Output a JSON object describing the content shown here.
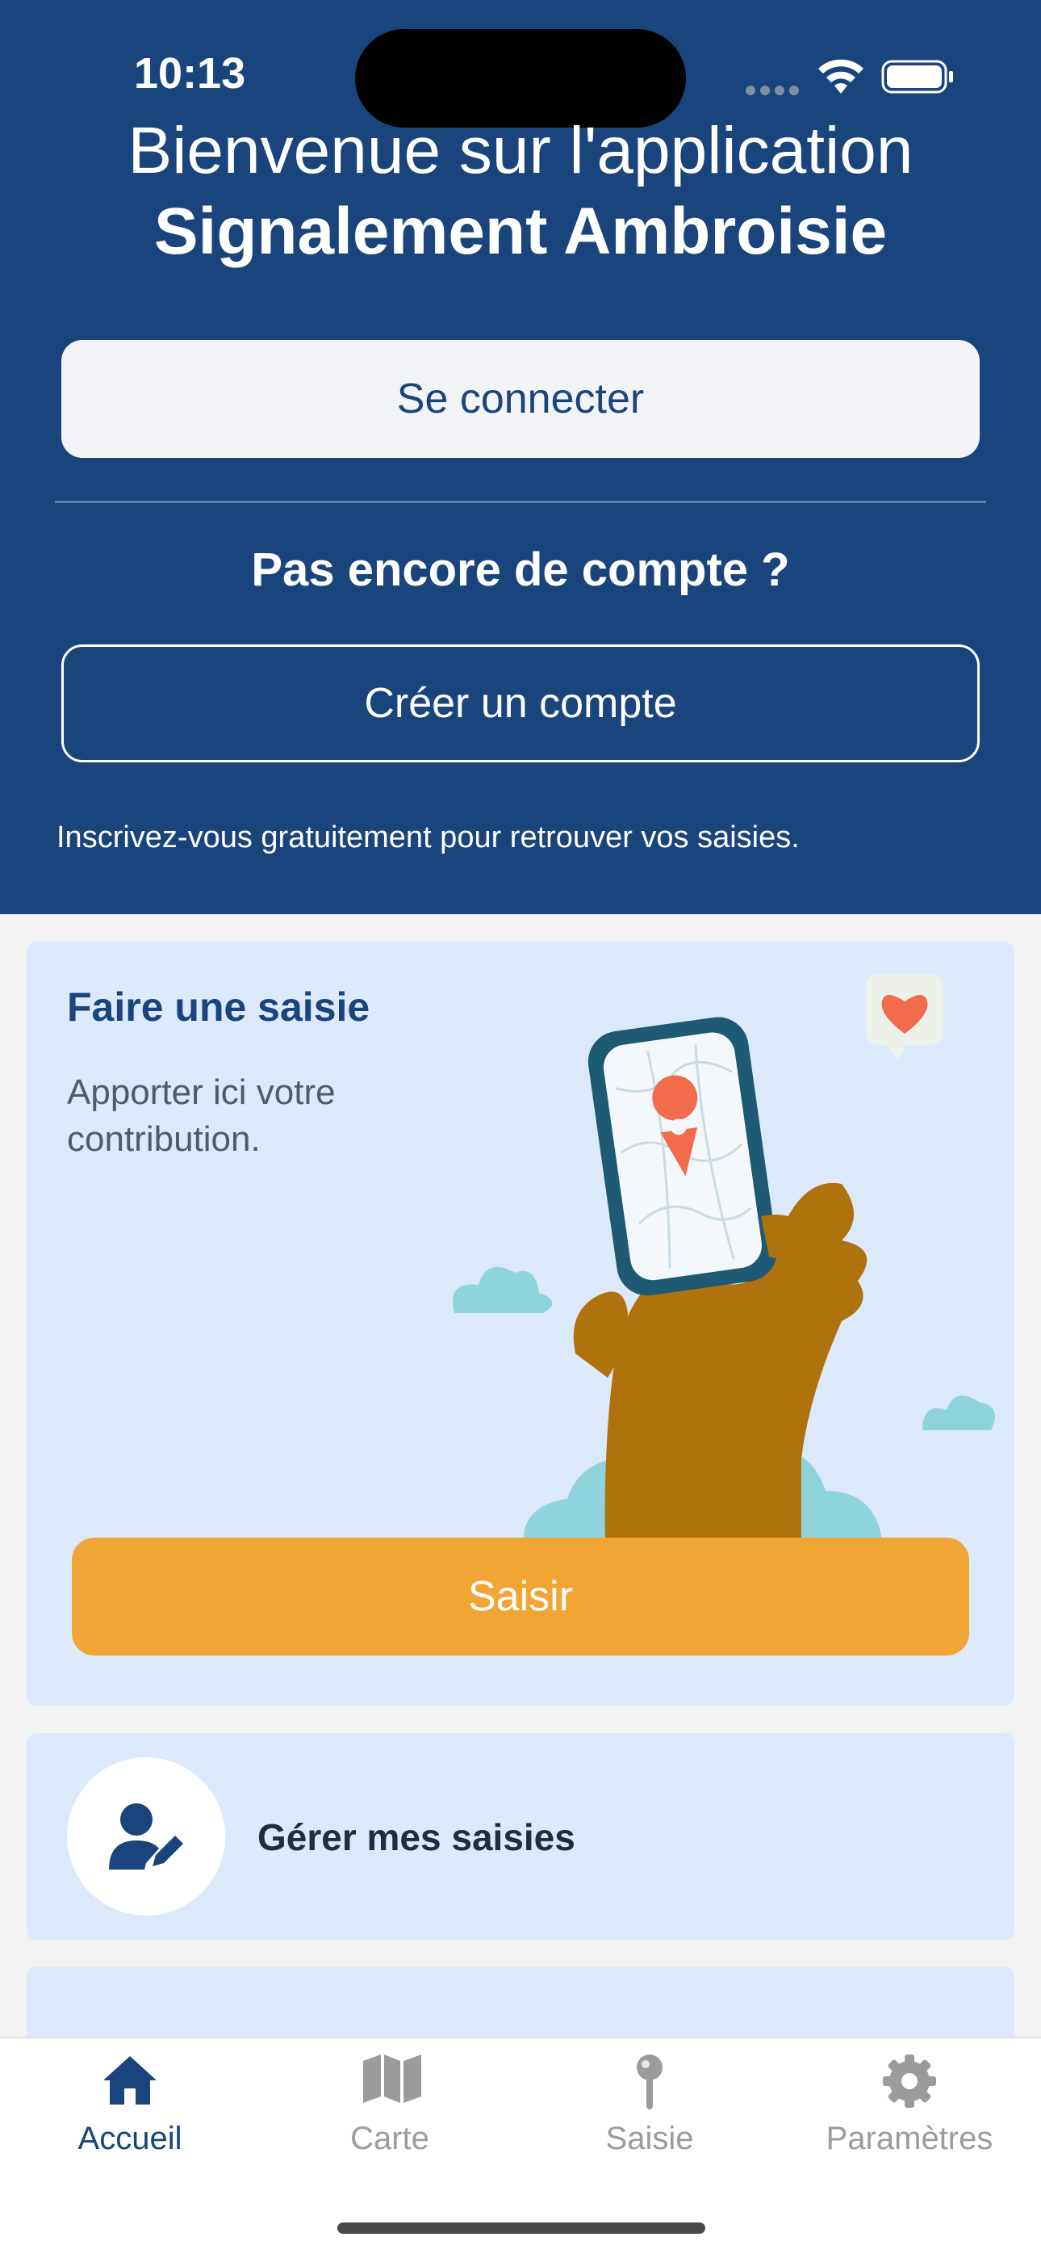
{
  "status_bar": {
    "time": "10:13"
  },
  "header": {
    "welcome_line1": "Bienvenue sur l'application",
    "welcome_line2": "Signalement Ambroisie",
    "login_label": "Se connecter",
    "no_account_label": "Pas encore de compte ?",
    "create_account_label": "Créer un compte",
    "signup_note": "Inscrivez-vous gratuitement pour retrouver vos saisies."
  },
  "entry_card": {
    "title": "Faire une saisie",
    "description": "Apporter ici votre contribution.",
    "button_label": "Saisir"
  },
  "manage_card": {
    "label": "Gérer mes saisies"
  },
  "tabbar": {
    "items": [
      {
        "label": "Accueil",
        "icon": "home-icon",
        "active": true
      },
      {
        "label": "Carte",
        "icon": "map-icon",
        "active": false
      },
      {
        "label": "Saisie",
        "icon": "pin-icon",
        "active": false
      },
      {
        "label": "Paramètres",
        "icon": "gear-icon",
        "active": false
      }
    ]
  },
  "colors": {
    "primary": "#19447c",
    "accent": "#f0a535",
    "card_background": "#dbe9fb",
    "page_background": "#f2f2f2"
  }
}
